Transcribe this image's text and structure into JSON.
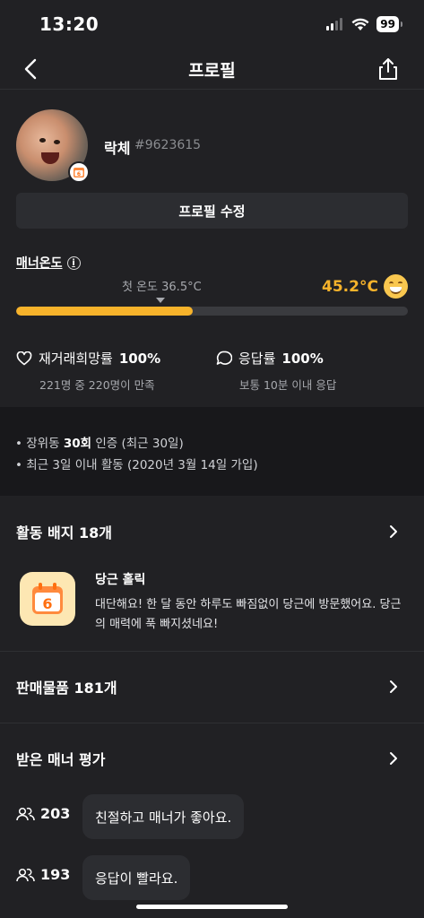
{
  "status_bar": {
    "time": "13:20",
    "battery": "99"
  },
  "nav": {
    "title": "프로필"
  },
  "profile": {
    "nickname": "락체",
    "user_id": "#9623615",
    "edit_label": "프로필 수정"
  },
  "manner": {
    "label": "매너온도",
    "first_temp_label": "첫 온도 36.5°C",
    "temperature": "45.2°C",
    "fill_fraction": 0.45,
    "accent_color": "#f7b32b"
  },
  "stats": [
    {
      "icon": "heart-icon",
      "label": "재거래희망률",
      "value": "100%",
      "sub": "221명 중 220명이 만족"
    },
    {
      "icon": "chat-bubble-icon",
      "label": "응답률",
      "value": "100%",
      "sub": "보통 10분 이내 응답"
    }
  ],
  "info": {
    "line1_prefix": "장위동",
    "line1_count": "30회",
    "line1_suffix": "인증 (최근 30일)",
    "line2": "최근 3일 이내 활동 (2020년 3월 14일 가입)"
  },
  "badges": {
    "title": "활동 배지 18개",
    "item": {
      "title": "당근 홀릭",
      "description": "대단해요! 한 달 동안 하루도 빠짐없이 당근에 방문했어요. 당근의 매력에 푹 빠지셨네요!"
    }
  },
  "sales": {
    "title": "판매물품 181개"
  },
  "manner_reviews": {
    "title": "받은 매너 평가",
    "items": [
      {
        "count": "203",
        "text": "친절하고 매너가 좋아요."
      },
      {
        "count": "193",
        "text": "응답이 빨라요."
      }
    ]
  }
}
